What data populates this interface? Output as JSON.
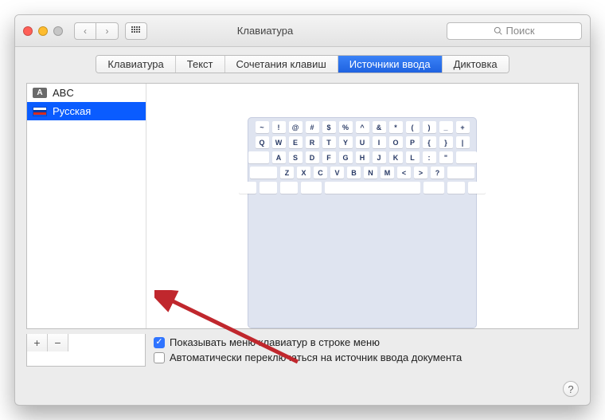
{
  "window": {
    "title": "Клавиатура"
  },
  "toolbar": {
    "search_placeholder": "Поиск"
  },
  "tabs": [
    {
      "label": "Клавиатура"
    },
    {
      "label": "Текст"
    },
    {
      "label": "Сочетания клавиш"
    },
    {
      "label": "Источники ввода"
    },
    {
      "label": "Диктовка"
    }
  ],
  "selected_tab_index": 3,
  "sources": [
    {
      "label": "ABC"
    },
    {
      "label": "Русская"
    }
  ],
  "selected_source_index": 1,
  "keyboard_rows": [
    [
      "~",
      "!",
      "@",
      "#",
      "$",
      "%",
      "^",
      "&",
      "*",
      "(",
      ")",
      "_",
      "+"
    ],
    [
      "Q",
      "W",
      "E",
      "R",
      "T",
      "Y",
      "U",
      "I",
      "O",
      "P",
      "{",
      "}",
      "|"
    ],
    [
      "A",
      "S",
      "D",
      "F",
      "G",
      "H",
      "J",
      "K",
      "L",
      ":",
      "\""
    ],
    [
      "Z",
      "X",
      "C",
      "V",
      "B",
      "N",
      "M",
      "<",
      ">",
      "?"
    ]
  ],
  "checkboxes": {
    "show_menu": {
      "label": "Показывать меню клавиатур в строке меню",
      "checked": true
    },
    "auto_switch": {
      "label": "Автоматически переключаться на источник ввода документа",
      "checked": false
    }
  },
  "buttons": {
    "add": "+",
    "remove": "−"
  }
}
